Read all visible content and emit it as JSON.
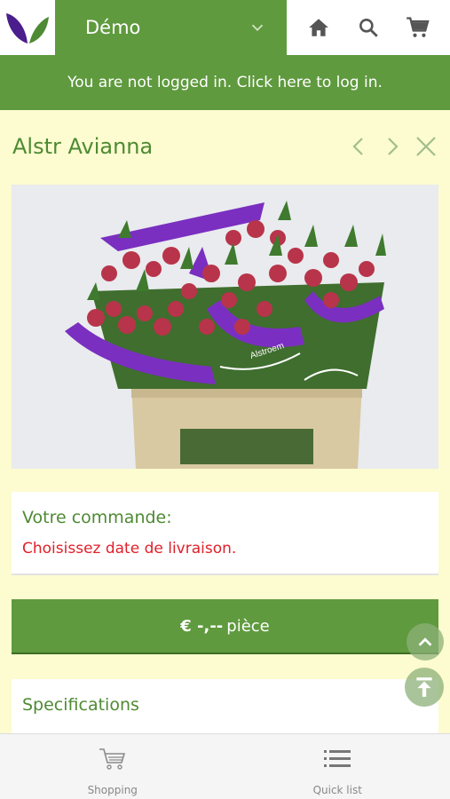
{
  "header": {
    "shop_name": "Démo",
    "login_prompt": "You are not logged in. Click here to log in."
  },
  "product": {
    "name": "Alstr Avianna",
    "sleeve_text": "Alstroem"
  },
  "order": {
    "label": "Votre commande:",
    "delivery_warning": "Choisissez date de livraison."
  },
  "price": {
    "currency_value": "€ -,--",
    "unit": "pièce"
  },
  "specifications": {
    "label": "Specifications"
  },
  "bottom_nav": {
    "shopping_label": "Shopping",
    "quicklist_label": "Quick list"
  },
  "colors": {
    "brand_green": "#5f9a3e",
    "background": "#fdfbd0",
    "warning_red": "#e0202a",
    "logo_purple": "#4a1e8c"
  }
}
